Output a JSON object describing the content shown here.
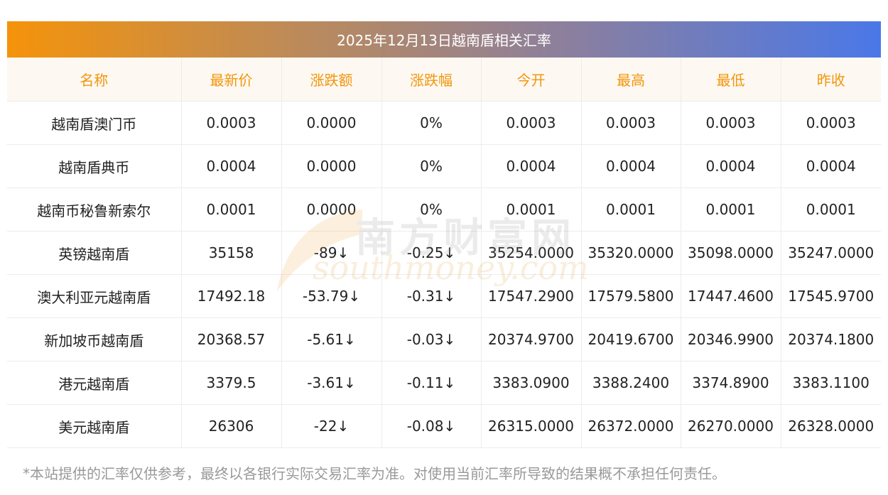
{
  "title": "2025年12月13日越南盾相关汇率",
  "headers": [
    "名称",
    "最新价",
    "涨跌额",
    "涨跌幅",
    "今开",
    "最高",
    "最低",
    "昨收"
  ],
  "rows": [
    {
      "name": "越南盾澳门币",
      "latest": "0.0003",
      "change": "0.0000",
      "change_pct": "0%",
      "open": "0.0003",
      "high": "0.0003",
      "low": "0.0003",
      "prev_close": "0.0003",
      "trend": "flat"
    },
    {
      "name": "越南盾典币",
      "latest": "0.0004",
      "change": "0.0000",
      "change_pct": "0%",
      "open": "0.0004",
      "high": "0.0004",
      "low": "0.0004",
      "prev_close": "0.0004",
      "trend": "flat"
    },
    {
      "name": "越南币秘鲁新索尔",
      "latest": "0.0001",
      "change": "0.0000",
      "change_pct": "0%",
      "open": "0.0001",
      "high": "0.0001",
      "low": "0.0001",
      "prev_close": "0.0001",
      "trend": "flat"
    },
    {
      "name": "英镑越南盾",
      "latest": "35158",
      "change": "-89↓",
      "change_pct": "-0.25↓",
      "open": "35254.0000",
      "high": "35320.0000",
      "low": "35098.0000",
      "prev_close": "35247.0000",
      "trend": "down"
    },
    {
      "name": "澳大利亚元越南盾",
      "latest": "17492.18",
      "change": "-53.79↓",
      "change_pct": "-0.31↓",
      "open": "17547.2900",
      "high": "17579.5800",
      "low": "17447.4600",
      "prev_close": "17545.9700",
      "trend": "down"
    },
    {
      "name": "新加坡币越南盾",
      "latest": "20368.57",
      "change": "-5.61↓",
      "change_pct": "-0.03↓",
      "open": "20374.9700",
      "high": "20419.6700",
      "low": "20346.9900",
      "prev_close": "20374.1800",
      "trend": "down"
    },
    {
      "name": "港元越南盾",
      "latest": "3379.5",
      "change": "-3.61↓",
      "change_pct": "-0.11↓",
      "open": "3383.0900",
      "high": "3388.2400",
      "low": "3374.8900",
      "prev_close": "3383.1100",
      "trend": "down"
    },
    {
      "name": "美元越南盾",
      "latest": "26306",
      "change": "-22↓",
      "change_pct": "-0.08↓",
      "open": "26315.0000",
      "high": "26372.0000",
      "low": "26270.0000",
      "prev_close": "26328.0000",
      "trend": "down"
    }
  ],
  "watermark": {
    "cn": "南方财富网",
    "en": "southmoney.com"
  },
  "footnote": "*本站提供的汇率仅供参考，最终以各银行实际交易汇率为准。对使用当前汇率所导致的结果概不承担任何责任。",
  "colors": {
    "header_text": "#f2960c",
    "down": "#1f8a1f",
    "title_start": "#f5930a",
    "title_end": "#4a78e8"
  }
}
